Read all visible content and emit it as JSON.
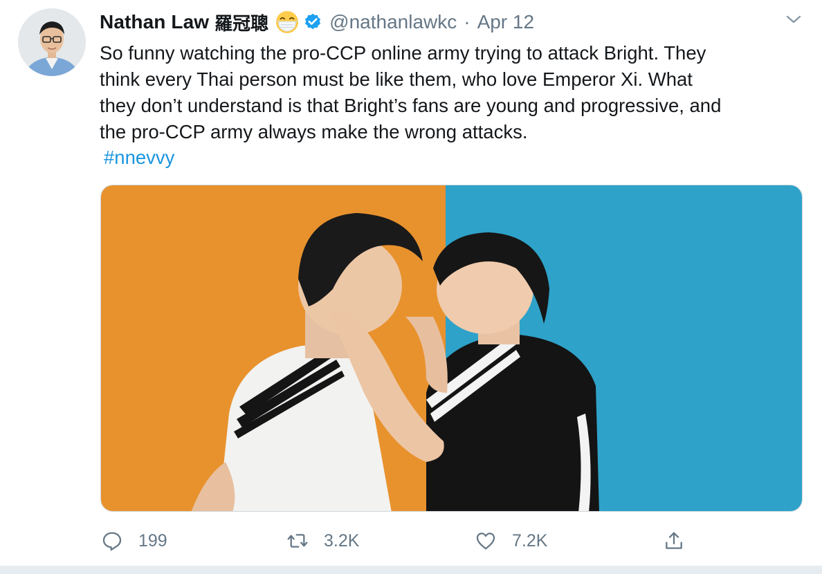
{
  "tweet": {
    "display_name": "Nathan Law",
    "display_name_cn": "羅冠聰",
    "handle": "@nathanlawkc",
    "separator": "·",
    "date": "Apr 12",
    "body_lines": [
      "So funny watching the pro-CCP online army trying to attack Bright. They",
      "think every Thai person must be like them, who love Emperor Xi. What",
      "they don’t understand is that Bright’s fans are young and progressive, and",
      "the pro-CCP army always make the wrong attacks."
    ],
    "hashtag": "#nnevvy",
    "icons": {
      "emoji": "face-with-medical-mask-icon",
      "verified": "verified-badge-icon",
      "caret": "chevron-down-icon"
    }
  },
  "actions": {
    "reply_count": "199",
    "retweet_count": "3.2K",
    "like_count": "7.2K"
  },
  "colors": {
    "text": "#14171a",
    "secondary": "#657786",
    "link": "#1b95e0",
    "verified": "#1da1f2",
    "photo_left_bg": "#e8922e",
    "photo_right_bg": "#2ea2c9"
  }
}
